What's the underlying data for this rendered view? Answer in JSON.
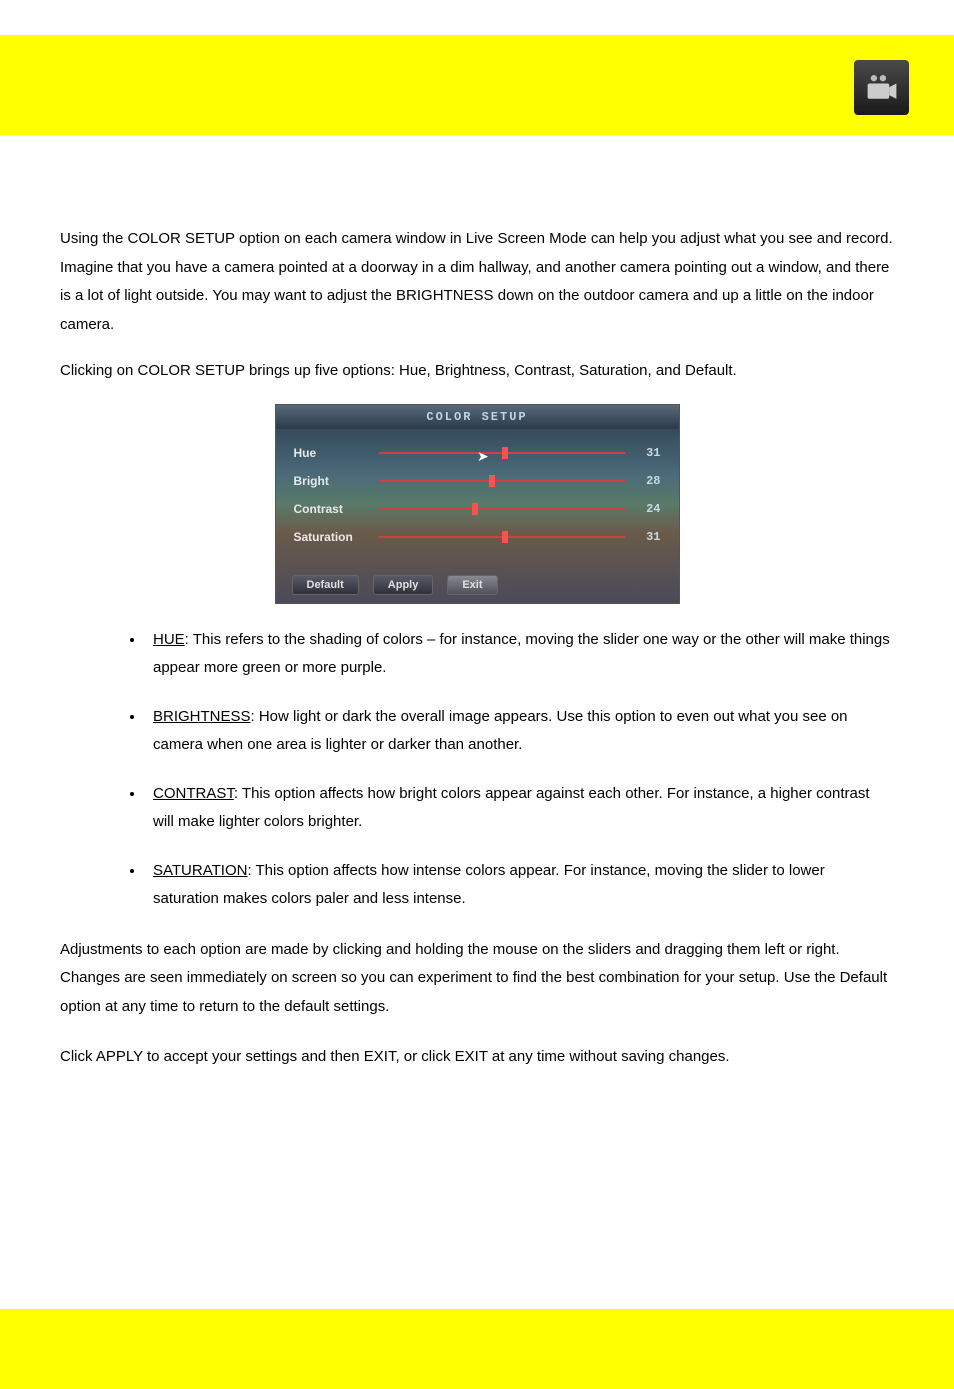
{
  "intro": {
    "p1": "Using the COLOR SETUP option on each camera window in Live Screen Mode can help you adjust what you see and record. Imagine that you have a camera pointed at a doorway in a dim hallway, and another camera pointing out a window, and there is a lot of light outside. You may want to adjust the BRIGHTNESS down on the outdoor camera and up a little on the indoor camera.",
    "p2": "Clicking on COLOR SETUP brings up five options: Hue, Brightness, Contrast, Saturation, and Default."
  },
  "screenshot": {
    "title": "COLOR SETUP",
    "rows": [
      {
        "label": "Hue",
        "value": "31",
        "pct": 50
      },
      {
        "label": "Bright",
        "value": "28",
        "pct": 45
      },
      {
        "label": "Contrast",
        "value": "24",
        "pct": 38
      },
      {
        "label": "Saturation",
        "value": "31",
        "pct": 50
      }
    ],
    "buttons": {
      "default": "Default",
      "apply": "Apply",
      "exit": "Exit"
    }
  },
  "defs": {
    "hue": {
      "term": "HUE",
      "text": ": This refers to the shading of colors – for instance, moving the slider one way or the other will make things appear more green or more purple."
    },
    "brightness": {
      "term": "BRIGHTNESS",
      "text": ": How light or dark the overall image appears. Use this option to even out what you see on camera when one area is lighter or darker than another."
    },
    "contrast": {
      "term": "CONTRAST",
      "text": ": This option affects how bright colors appear against each other. For instance, a higher contrast will make lighter colors brighter."
    },
    "saturation": {
      "term": "SATURATION",
      "text": ": This option affects how intense colors appear. For instance, moving the slider to lower saturation makes colors paler and less intense."
    }
  },
  "closing": {
    "p1": "Adjustments to each option are made by clicking and holding the mouse on the sliders and dragging them left or right. Changes are seen immediately on screen so you can experiment to find the best combination for your setup. Use the Default option at any time to return to the default settings.",
    "p2": "Click APPLY to accept your settings and then EXIT, or click EXIT at any time without saving changes."
  }
}
